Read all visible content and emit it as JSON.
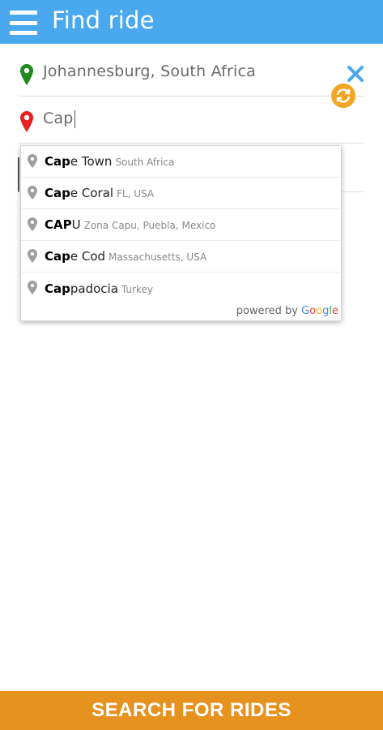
{
  "header": {
    "title": "Find ride",
    "menu_icon": "hamburger-menu-icon",
    "background_color": "#4aa8ee"
  },
  "origin": {
    "value": "Johannesburg, South Africa",
    "pin_color": "#1e8a1e"
  },
  "destination": {
    "value": "Cap",
    "pin_color": "#e82020"
  },
  "actions": {
    "clear_icon": "close-icon",
    "swap_icon": "swap-refresh-icon",
    "swap_color": "#f3a623"
  },
  "suggestions": [
    {
      "match": "Cap",
      "rest": "e Town",
      "secondary": "South Africa"
    },
    {
      "match": "Cap",
      "rest": "e Coral",
      "secondary": "FL, USA"
    },
    {
      "match": "CAP",
      "rest": "U",
      "secondary": "Zona Capu, Puebla, Mexico"
    },
    {
      "match": "Cap",
      "rest": "e Cod",
      "secondary": "Massachusetts, USA"
    },
    {
      "match": "Cap",
      "rest": "padocia",
      "secondary": "Turkey"
    }
  ],
  "attribution": {
    "prefix": "powered by",
    "brand_letters": [
      "G",
      "o",
      "o",
      "g",
      "l",
      "e"
    ]
  },
  "footer": {
    "button_label": "SEARCH FOR RIDES",
    "button_color": "#e6921f"
  }
}
